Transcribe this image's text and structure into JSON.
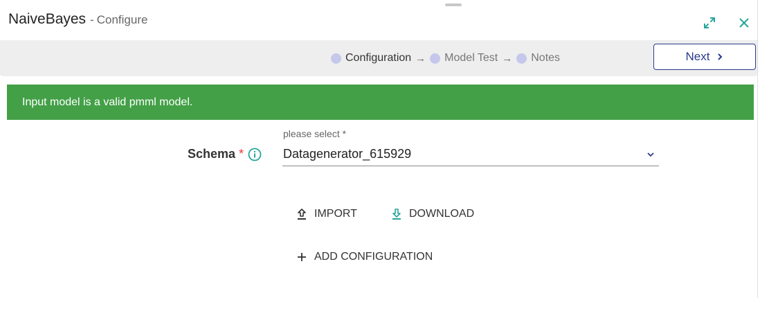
{
  "header": {
    "title": "NaiveBayes",
    "separator": "-",
    "subtitle": "Configure",
    "expand_icon": "expand-icon",
    "close_icon": "close-icon"
  },
  "stepper": {
    "steps": [
      {
        "label": "Configuration",
        "active": true
      },
      {
        "label": "Model Test",
        "active": false
      },
      {
        "label": "Notes",
        "active": false
      }
    ],
    "arrow": "→",
    "next_label": "Next"
  },
  "alert": {
    "message": "Input model is a valid pmml model.",
    "color": "#43a047"
  },
  "form": {
    "schema_label": "Schema",
    "required_mark": "*",
    "select_hint": "please select *",
    "select_value": "Datagenerator_615929"
  },
  "actions": {
    "import_label": "IMPORT",
    "download_label": "DOWNLOAD",
    "add_configuration_label": "ADD CONFIGURATION"
  },
  "colors": {
    "accent": "#26a69a",
    "primary": "#2b3a8c",
    "step_dot": "#c5c8eb",
    "required": "#e53935"
  }
}
